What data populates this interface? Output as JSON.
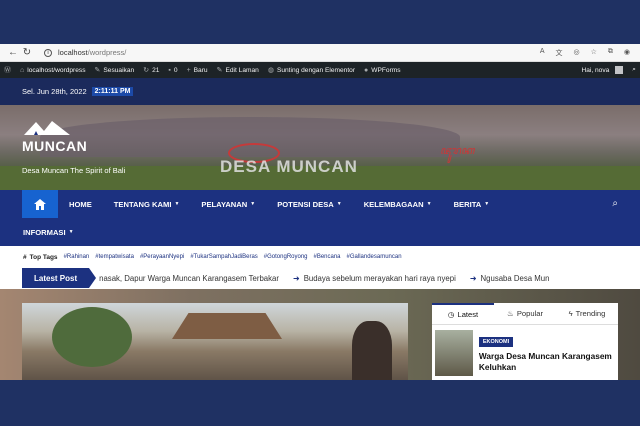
{
  "browser": {
    "url_host": "localhost",
    "url_path": "/wordpress/"
  },
  "admin_bar": {
    "site": "localhost/wordpress",
    "customize": "Sesuaikan",
    "updates_count": "21",
    "comments_count": "0",
    "new": "Baru",
    "edit_page": "Edit Laman",
    "edit_elementor": "Sunting dengan Elementor",
    "wpforms": "WPForms",
    "greeting": "Hai, nova"
  },
  "date_bar": {
    "date": "Sel. Jun 28th, 2022",
    "time": "2:11:11 PM"
  },
  "header": {
    "title": "MUNCAN",
    "tagline": "Desa Muncan The Spirit of Bali",
    "hill_text": "DESA MUNCAN"
  },
  "nav": {
    "items": [
      {
        "label": "HOME",
        "dropdown": false
      },
      {
        "label": "TENTANG KAMI",
        "dropdown": true
      },
      {
        "label": "PELAYANAN",
        "dropdown": true
      },
      {
        "label": "POTENSI DESA",
        "dropdown": true
      },
      {
        "label": "KELEMBAGAAN",
        "dropdown": true
      },
      {
        "label": "BERITA",
        "dropdown": true
      }
    ],
    "second_row": {
      "label": "INFORMASI",
      "dropdown": true
    }
  },
  "tags": {
    "title": "Top Tags",
    "items": [
      "#Rahinan",
      "#tempatwisata",
      "#PerayaanNyepi",
      "#TukarSampahJadiBeras",
      "#GotongRoyong",
      "#Bencana",
      "#Gallandesamuncan"
    ]
  },
  "ticker": {
    "label": "Latest Post",
    "items": [
      "nasak, Dapur Warga Muncan Karangasem Terbakar",
      "Budaya sebelum merayakan hari raya nyepi",
      "Ngusaba Desa Mun"
    ]
  },
  "widget": {
    "tabs": [
      {
        "label": "Latest",
        "icon": "clock-icon"
      },
      {
        "label": "Popular",
        "icon": "fire-icon"
      },
      {
        "label": "Trending",
        "icon": "bolt-icon"
      }
    ],
    "post": {
      "category": "EKONOMI",
      "title": "Warga Desa Muncan Karangasem Keluhkan"
    }
  },
  "colors": {
    "navy": "#1c3180",
    "accent_blue": "#1763d0",
    "page_bg": "#1f3163"
  }
}
